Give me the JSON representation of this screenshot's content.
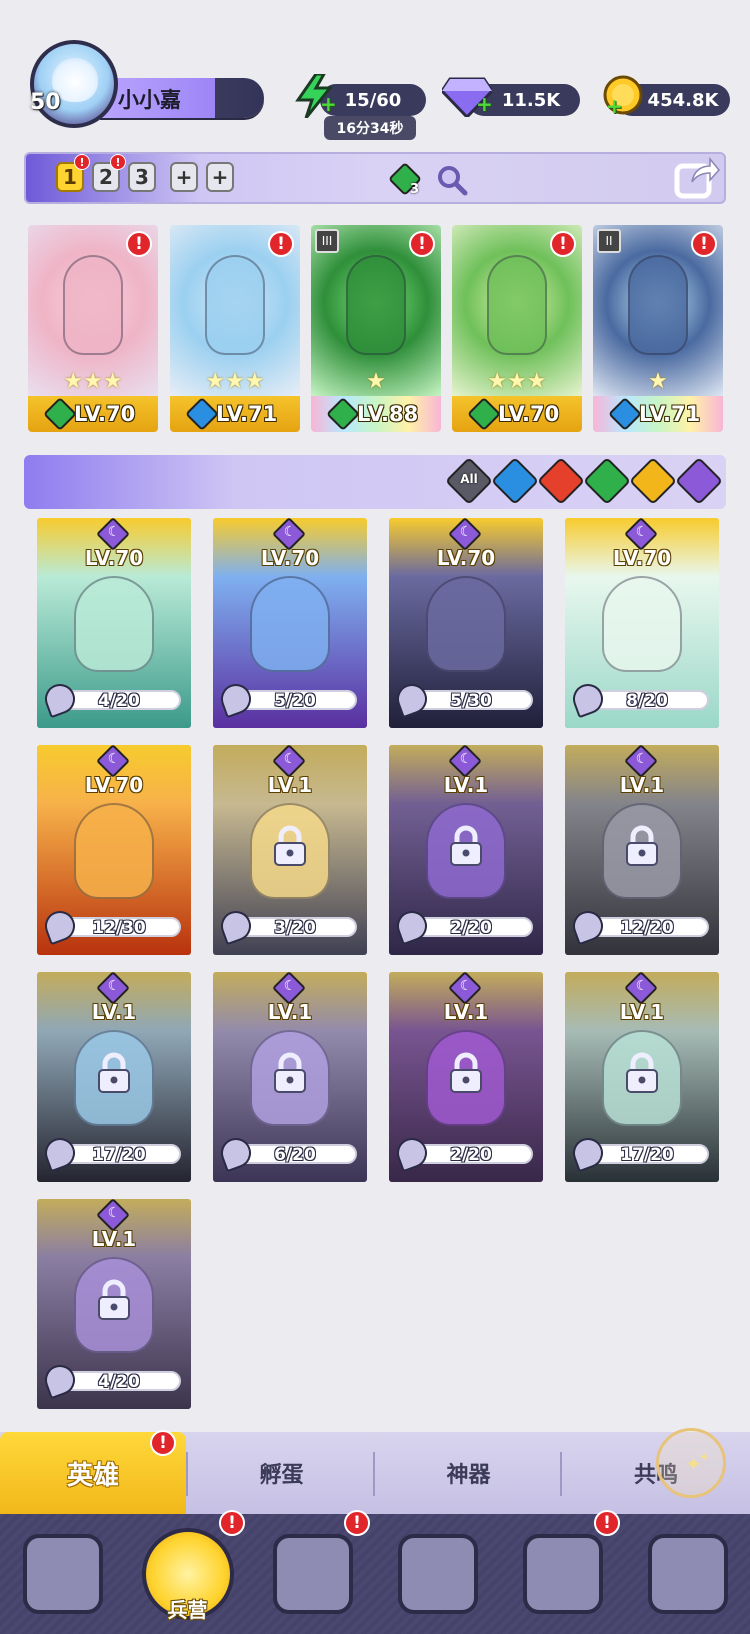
{
  "player": {
    "name": "小小嘉",
    "level": "50"
  },
  "resources": {
    "energy": {
      "value": "15/60",
      "timer": "16分34秒"
    },
    "gems": {
      "value": "11.5K"
    },
    "gold": {
      "value": "454.8K"
    }
  },
  "team_tabs": [
    {
      "label": "1",
      "active": true,
      "alert": true
    },
    {
      "label": "2",
      "active": false,
      "alert": true
    },
    {
      "label": "3",
      "active": false,
      "alert": false
    },
    {
      "label": "+",
      "active": false,
      "alert": false
    },
    {
      "label": "+",
      "active": false,
      "alert": false
    }
  ],
  "team_power_count": "3",
  "team": [
    {
      "level": "LV.70",
      "element": "forest",
      "element_color": "#2fb04a",
      "stars": "★★★",
      "tier": "",
      "alert": true
    },
    {
      "level": "LV.71",
      "element": "water",
      "element_color": "#2a8fe0",
      "stars": "★★★",
      "tier": "",
      "alert": true
    },
    {
      "level": "LV.88",
      "element": "forest",
      "element_color": "#2fb04a",
      "stars": "★",
      "tier": "III",
      "alert": true
    },
    {
      "level": "LV.70",
      "element": "forest",
      "element_color": "#2fb04a",
      "stars": "★★★",
      "tier": "",
      "alert": true
    },
    {
      "level": "LV.71",
      "element": "water",
      "element_color": "#2a8fe0",
      "stars": "★",
      "tier": "II",
      "alert": true
    }
  ],
  "filters": [
    {
      "label": "All",
      "name": "all",
      "color": "#5a5a66"
    },
    {
      "label": "",
      "name": "water",
      "color": "#2a8fe0"
    },
    {
      "label": "",
      "name": "fire",
      "color": "#e4402c"
    },
    {
      "label": "",
      "name": "forest",
      "color": "#2fb04a"
    },
    {
      "label": "",
      "name": "light",
      "color": "#f2b51a"
    },
    {
      "label": "",
      "name": "dark",
      "color": "#8c5ad8"
    }
  ],
  "heroes": [
    {
      "level": "LV.70",
      "shards": "4/20",
      "locked": false
    },
    {
      "level": "LV.70",
      "shards": "5/20",
      "locked": false
    },
    {
      "level": "LV.70",
      "shards": "5/30",
      "locked": false
    },
    {
      "level": "LV.70",
      "shards": "8/20",
      "locked": false
    },
    {
      "level": "LV.70",
      "shards": "12/30",
      "locked": false
    },
    {
      "level": "LV.1",
      "shards": "3/20",
      "locked": true
    },
    {
      "level": "LV.1",
      "shards": "2/20",
      "locked": true
    },
    {
      "level": "LV.1",
      "shards": "12/20",
      "locked": true
    },
    {
      "level": "LV.1",
      "shards": "17/20",
      "locked": true
    },
    {
      "level": "LV.1",
      "shards": "6/20",
      "locked": true
    },
    {
      "level": "LV.1",
      "shards": "2/20",
      "locked": true
    },
    {
      "level": "LV.1",
      "shards": "17/20",
      "locked": true
    },
    {
      "level": "LV.1",
      "shards": "4/20",
      "locked": true
    }
  ],
  "sub_tabs": [
    {
      "label": "英雄",
      "active": true,
      "alert": true
    },
    {
      "label": "孵蛋",
      "active": false,
      "alert": false
    },
    {
      "label": "神器",
      "active": false,
      "alert": false
    },
    {
      "label": "共鸣",
      "active": false,
      "alert": false
    }
  ],
  "nav": [
    {
      "name": "cards",
      "label": "",
      "active": false,
      "alert": false
    },
    {
      "name": "barracks",
      "label": "兵营",
      "active": true,
      "alert": true
    },
    {
      "name": "map",
      "label": "",
      "active": false,
      "alert": true
    },
    {
      "name": "castle",
      "label": "",
      "active": false,
      "alert": false
    },
    {
      "name": "mushroom",
      "label": "",
      "active": false,
      "alert": true
    },
    {
      "name": "guild",
      "label": "",
      "active": false,
      "alert": false
    }
  ],
  "colors": {
    "accent": "#ffd430",
    "alert": "#e0262b",
    "dark_element": "#8c5ad8"
  }
}
